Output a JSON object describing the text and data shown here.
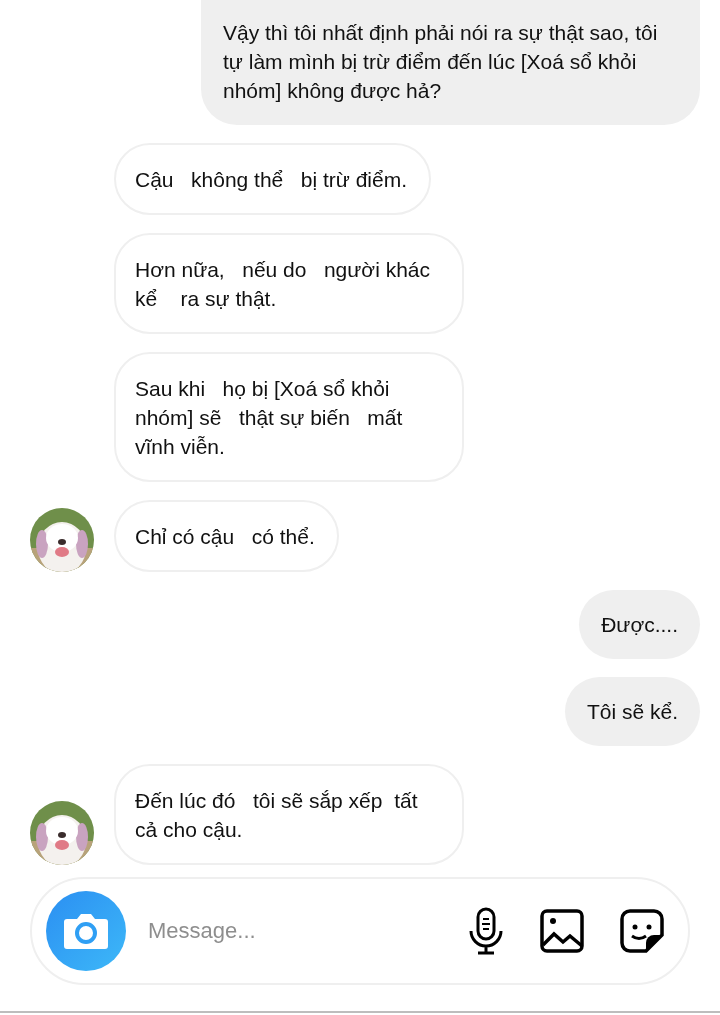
{
  "messages": [
    {
      "kind": "out",
      "text": "Vậy thì tôi nhất định phải nói ra sự thật sao, tôi tự làm mình bị trừ điểm đến lúc [Xoá sổ khỏi nhóm] không được hả?"
    },
    {
      "kind": "in",
      "text": "Cậu   không thể   bị trừ điểm.",
      "avatar": false
    },
    {
      "kind": "in",
      "text": "Hơn nữa,   nếu do   người khác kể    ra sự thật.",
      "avatar": false
    },
    {
      "kind": "in",
      "text": "Sau khi   họ bị [Xoá sổ khỏi nhóm] sẽ   thật sự biến   mất vĩnh viễn.",
      "avatar": false
    },
    {
      "kind": "in",
      "text": "Chỉ có cậu   có thể.",
      "avatar": true
    },
    {
      "kind": "out",
      "text": "Được...."
    },
    {
      "kind": "out",
      "text": "Tôi sẽ kể."
    },
    {
      "kind": "in",
      "text": "Đến lúc đó   tôi sẽ sắp xếp  tất cả cho cậu.",
      "avatar": true
    }
  ],
  "composer": {
    "placeholder": "Message..."
  }
}
